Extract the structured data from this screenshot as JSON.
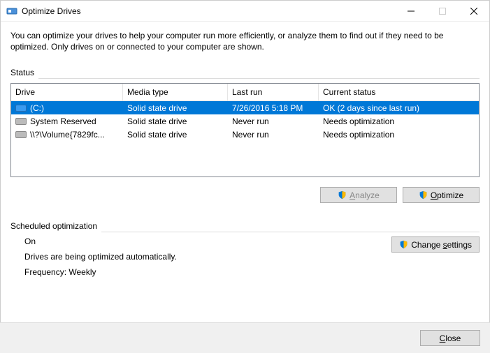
{
  "window": {
    "title": "Optimize Drives"
  },
  "intro": "You can optimize your drives to help your computer run more efficiently, or analyze them to find out if they need to be optimized. Only drives on or connected to your computer are shown.",
  "status": {
    "label": "Status",
    "headers": {
      "drive": "Drive",
      "media": "Media type",
      "last": "Last run",
      "status": "Current status"
    },
    "rows": [
      {
        "icon": "drive-blue",
        "name": "(C:)",
        "media": "Solid state drive",
        "last": "7/26/2016 5:18 PM",
        "status": "OK (2 days since last run)",
        "selected": true
      },
      {
        "icon": "drive-gray",
        "name": "System Reserved",
        "media": "Solid state drive",
        "last": "Never run",
        "status": "Needs optimization",
        "selected": false
      },
      {
        "icon": "drive-gray",
        "name": "\\\\?\\Volume{7829fc...",
        "media": "Solid state drive",
        "last": "Never run",
        "status": "Needs optimization",
        "selected": false
      }
    ]
  },
  "buttons": {
    "analyze": "Analyze",
    "optimize": "Optimize",
    "change_settings": "Change settings",
    "close": "Close"
  },
  "schedule": {
    "label": "Scheduled optimization",
    "state": "On",
    "desc": "Drives are being optimized automatically.",
    "freq": "Frequency: Weekly"
  }
}
